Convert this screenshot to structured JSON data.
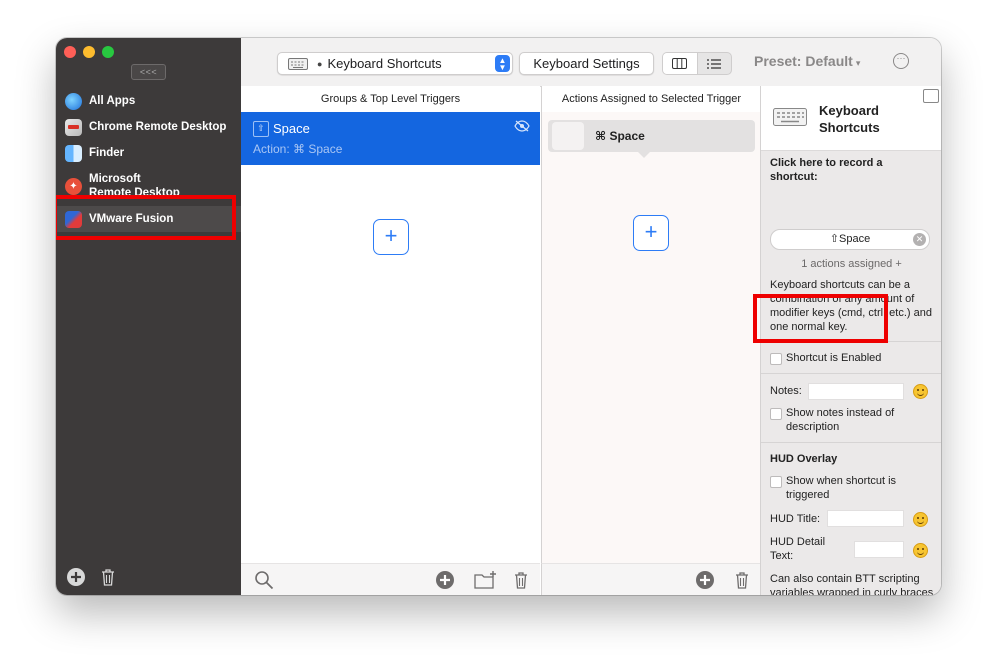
{
  "sidebar": {
    "collapse_label": "<<<",
    "apps": [
      {
        "label": "All Apps",
        "icon": "all-apps-icon"
      },
      {
        "label": "Chrome Remote Desktop",
        "icon": "chrome-remote-desktop-icon"
      },
      {
        "label": "Finder",
        "icon": "finder-icon"
      },
      {
        "label": "Microsoft\nRemote Desktop",
        "icon": "microsoft-remote-desktop-icon"
      },
      {
        "label": "VMware Fusion",
        "icon": "vmware-fusion-icon",
        "selected": true
      }
    ]
  },
  "toolbar": {
    "preset_select_value": "Keyboard Shortcuts",
    "keyboard_settings_label": "Keyboard Settings",
    "preset_label": "Preset: Default",
    "more_label": "···"
  },
  "groups": {
    "header": "Groups & Top Level Triggers",
    "items": [
      {
        "name": "Space",
        "subtitle": "Action: ⌘ Space"
      }
    ],
    "add_label": "+"
  },
  "actions": {
    "header": "Actions Assigned to Selected Trigger",
    "items": [
      {
        "name": "⌘ Space"
      }
    ],
    "add_label": "+"
  },
  "details": {
    "title": "Keyboard Shortcuts",
    "record_label": "Click here to record a shortcut:",
    "shortcut_value": "⇧Space",
    "actions_assigned": "1 actions assigned +",
    "help_text": "Keyboard shortcuts can be a combination of any amount of modifier keys (cmd, ctrl, etc.) and one normal key.",
    "enabled_label": "Shortcut is Enabled",
    "notes_label": "Notes:",
    "show_notes_label": "Show notes instead of description",
    "hud_heading": "HUD Overlay",
    "hud_show_label": "Show when shortcut is triggered",
    "hud_title_label": "HUD Title:",
    "hud_detail_label": "HUD Detail Text:",
    "btt_text": "Can also contain BTT scripting variables wrapped in curly braces {}"
  },
  "colors": {
    "accent": "#2d7cf6",
    "selection": "#1466e0",
    "highlight": "#ee0000",
    "sidebar_bg": "#3d3a3a"
  }
}
